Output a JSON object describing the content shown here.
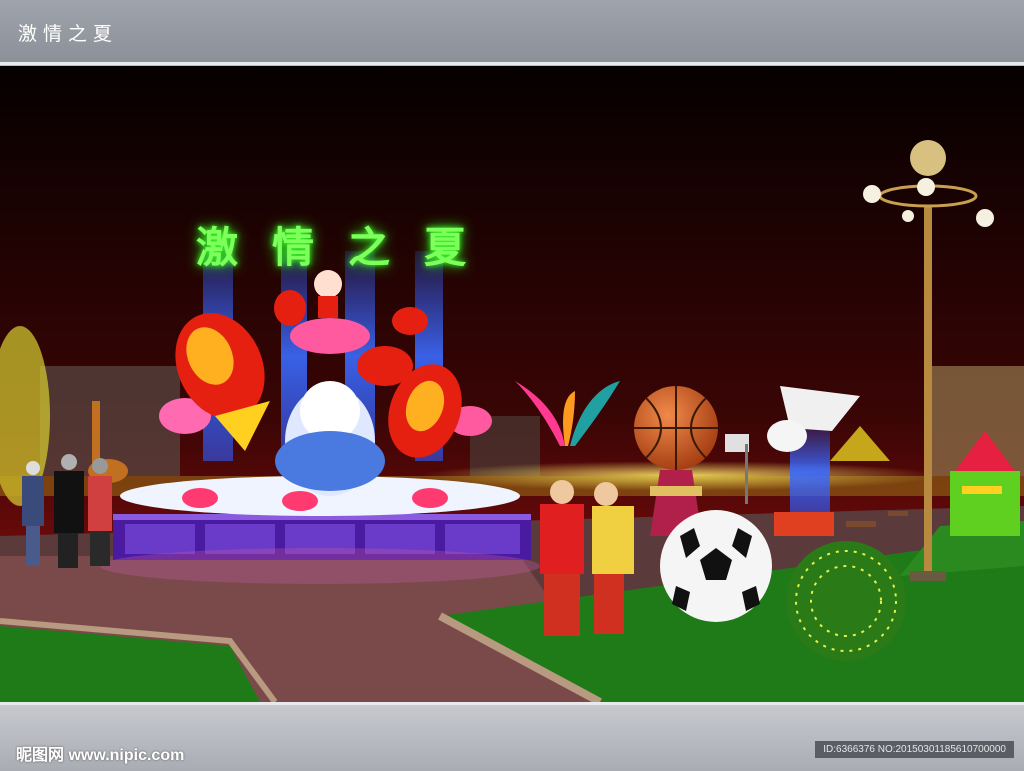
{
  "header": {
    "title": "激情之夏"
  },
  "sign": {
    "chars": [
      "激",
      "情",
      "之",
      "夏"
    ]
  },
  "footer": {
    "logo": "昵图网 www.nipic.com",
    "id_text": "ID:6366376 NO:20150301185610700000"
  },
  "colors": {
    "sky_top": "#0a0000",
    "sky_horizon": "#6a0a0a",
    "neon_green": "#7dff5c",
    "neon_blue": "#2f5bff",
    "grass": "#1f7a18",
    "fish_red": "#e62010"
  }
}
